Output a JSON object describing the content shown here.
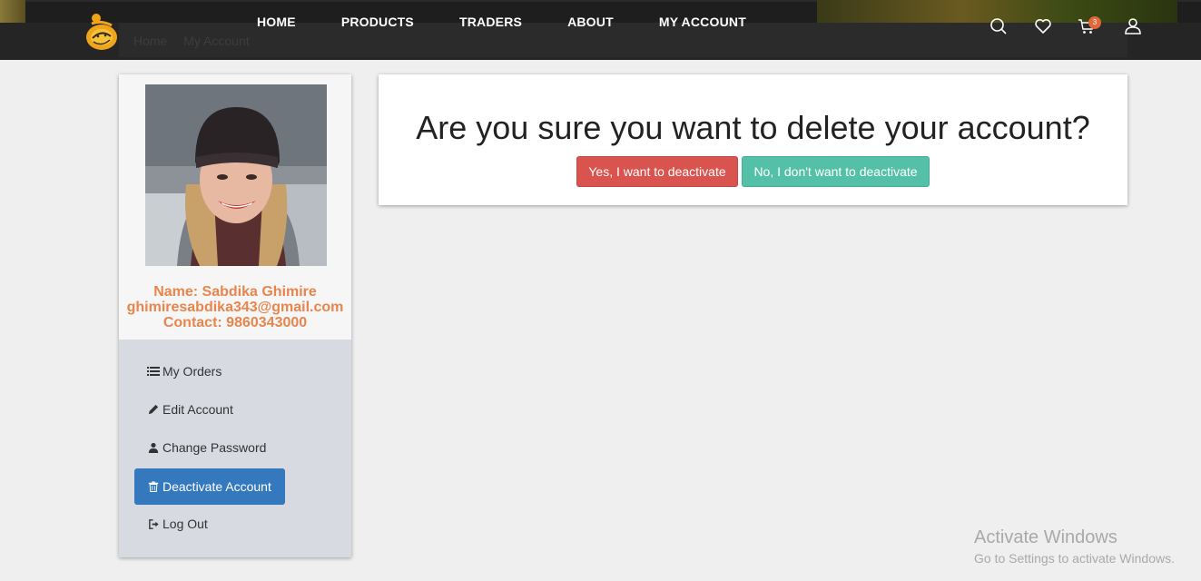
{
  "header": {
    "breadcrumb": [
      "Home",
      "My Account"
    ],
    "nav": [
      "HOME",
      "PRODUCTS",
      "TRADERS",
      "ABOUT",
      "MY ACCOUNT"
    ],
    "cart_count": "3",
    "icons": [
      "search-icon",
      "heart-icon",
      "cart-icon",
      "user-icon"
    ]
  },
  "profile": {
    "name": "Name: Sabdika Ghimire",
    "email": "ghimiresabdika343@gmail.com",
    "contact": "Contact: 9860343000"
  },
  "menu": {
    "orders": "My Orders",
    "edit": "Edit Account",
    "password": "Change Password",
    "deactivate": "Deactivate Account",
    "logout": "Log Out"
  },
  "dialog": {
    "question": "Are you sure you want to delete your account?",
    "yes": "Yes, I want to deactivate",
    "no": "No, I don't want to deactivate"
  },
  "watermark": {
    "title": "Activate Windows",
    "subtitle": "Go to Settings to activate Windows."
  },
  "colors": {
    "accent_orange": "#e8854d",
    "active_blue": "#3478bd",
    "danger": "#d9534f",
    "success": "#54c0a8"
  }
}
